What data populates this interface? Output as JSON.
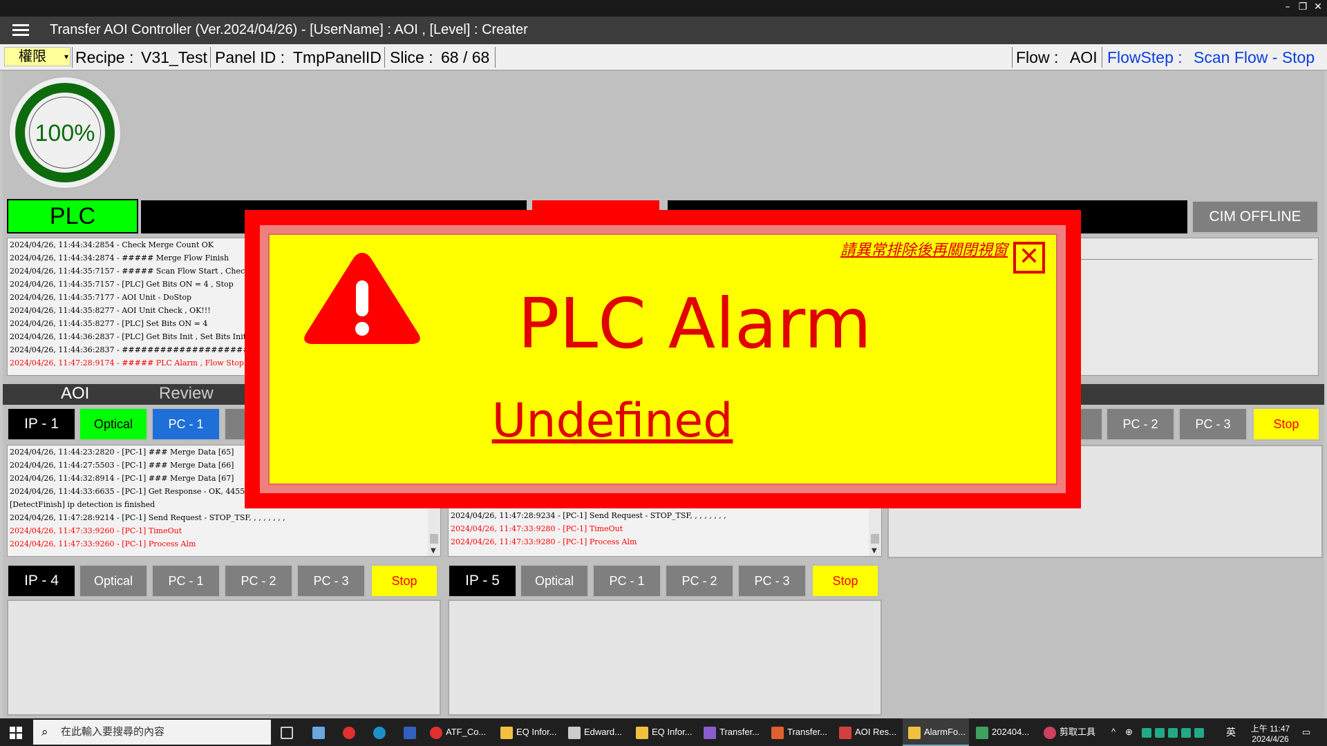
{
  "window": {
    "title": "Transfer AOI Controller (Ver.2024/04/26) - [UserName] : AOI , [Level] : Creater",
    "controls": [
      "–",
      "❐",
      "✕"
    ]
  },
  "info": {
    "permission": "權限",
    "recipe_label": "Recipe :",
    "recipe_value": "V31_Test",
    "panel_label": "Panel ID :",
    "panel_value": "TmpPanelID",
    "slice_label": "Slice :",
    "slice_value": "68 / 68",
    "flow_label": "Flow :",
    "flow_value": "AOI",
    "flowstep_label": "FlowStep :",
    "flowstep_value": "Scan Flow - Stop"
  },
  "gauge": {
    "percent": "100%",
    "color": "#0d6b0d"
  },
  "status": {
    "plc": "PLC",
    "cim": "CIM OFFLINE"
  },
  "main_log": [
    "2024/04/26, 11:44:34:2854 - Check Merge Count OK",
    "2024/04/26, 11:44:34:2874 - ##### Merge Flow Finish",
    "2024/04/26, 11:44:35:7157 - ##### Scan Flow Start , Check CM",
    "2024/04/26, 11:44:35:7157 - [PLC] Get Bits ON = 4 , Stop",
    "2024/04/26, 11:44:35:7177 - AOI Unit - DoStop",
    "2024/04/26, 11:44:35:8277 - AOI Unit Check , OK!!!",
    "2024/04/26, 11:44:35:8277 - [PLC] Set Bits ON = 4",
    "2024/04/26, 11:44:36:2837 - [PLC] Get Bits Init , Set Bits Init",
    "2024/04/26, 11:44:36:2837 - ##########################",
    "2024/04/26, 11:47:28:9174 - ##### PLC Alarm , Flow Stop"
  ],
  "tabs": [
    "AOI",
    "Review"
  ],
  "ip1": {
    "name": "IP - 1",
    "buttons": [
      "Optical",
      "PC - 1"
    ],
    "log": [
      "2024/04/26, 11:44:23:2820 - [PC-1] ### Merge Data [65]",
      "2024/04/26, 11:44:27:5503 - [PC-1] ### Merge Data [66]",
      "2024/04/26, 11:44:32:8914 - [PC-1] ### Merge Data [67]",
      "2024/04/26, 11:44:33:6635 - [PC-1] Get Response - OK, 4455,6",
      "[DetectFinish] ip detection is finished",
      "2024/04/26, 11:47:28:9214 - [PC-1] Send Request - STOP_TSF, , , , , , , ,",
      "2024/04/26, 11:47:33:9260 - [PC-1] TimeOut",
      "2024/04/26, 11:47:33:9260 - [PC-1] Process Alm"
    ]
  },
  "ip2": {
    "log": [
      "2024/04/26, 11:47:28:9234 - [PC-1] Send Request - STOP_TSF, , , , , , , ,",
      "2024/04/26, 11:47:33:9280 - [PC-1] TimeOut",
      "2024/04/26, 11:47:33:9280 - [PC-1] Process Alm"
    ]
  },
  "ip3": {
    "buttons": [
      "PC - 2",
      "PC - 3",
      "Stop"
    ]
  },
  "ip4": {
    "name": "IP - 4",
    "buttons": [
      "Optical",
      "PC - 1",
      "PC - 2",
      "PC - 3",
      "Stop"
    ]
  },
  "ip5": {
    "name": "IP - 5",
    "buttons": [
      "Optical",
      "PC - 1",
      "PC - 2",
      "PC - 3",
      "Stop"
    ]
  },
  "alarm": {
    "note": "請異常排除後再關閉視窗",
    "title": "PLC Alarm",
    "subtitle": "Undefined",
    "close": "✕"
  },
  "taskbar": {
    "search_placeholder": "在此輸入要搜尋的內容",
    "items": [
      "ATF_Co...",
      "EQ Infor...",
      "Edward...",
      "EQ Infor...",
      "Transfer...",
      "Transfer...",
      "AOI Res...",
      "AlarmFo...",
      "202404..."
    ],
    "snip": "剪取工具",
    "ime": "英",
    "time": "上午 11:47",
    "date": "2024/4/26"
  }
}
